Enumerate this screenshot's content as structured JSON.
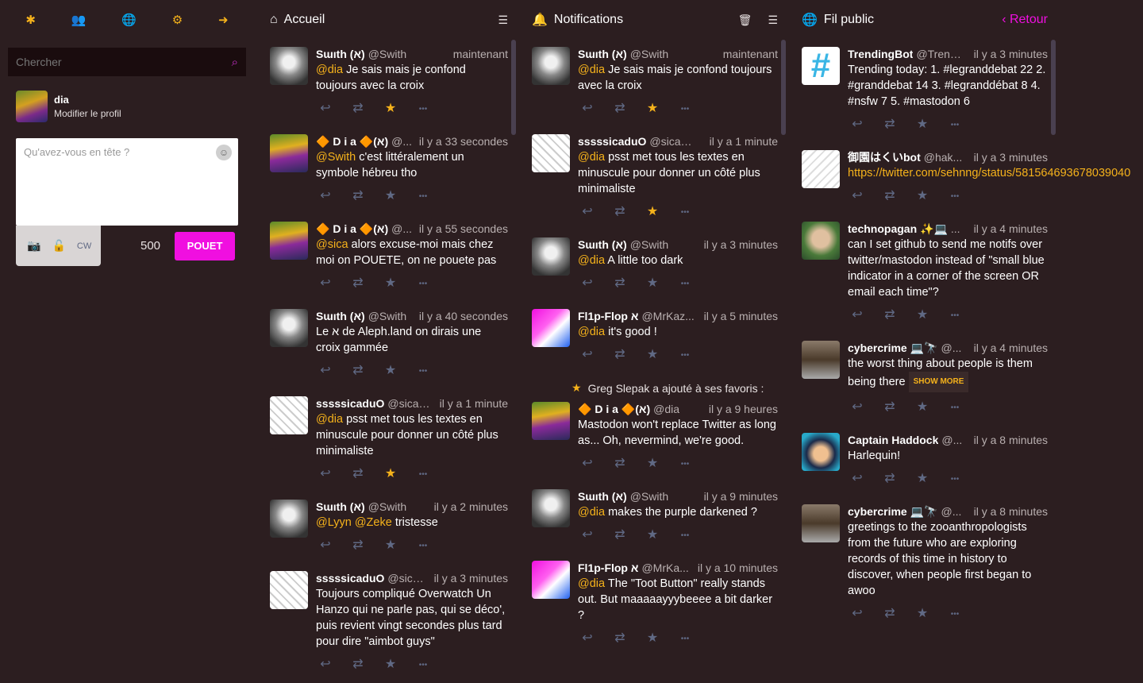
{
  "nav": {
    "items": [
      "getting-started-icon",
      "local-timeline-icon",
      "public-timeline-icon",
      "preferences-icon",
      "logout-icon"
    ]
  },
  "search": {
    "placeholder": "Chercher"
  },
  "profile": {
    "name": "dia",
    "edit": "Modifier le profil"
  },
  "compose": {
    "placeholder": "Qu'avez-vous en tête ?",
    "cw": "CW",
    "count": "500",
    "submit": "POUET"
  },
  "columns": {
    "home": {
      "title": "Accueil"
    },
    "notifications": {
      "title": "Notifications"
    },
    "public": {
      "title": "Fil public",
      "back": "Retour"
    }
  },
  "home": [
    {
      "name": "Sɯıth (א)",
      "acct": "@Swith",
      "time": "maintenant",
      "mention": "@dia",
      "text": " Je sais mais je confond toujours avec la croix",
      "fav": true,
      "avatar": "swith"
    },
    {
      "name": "🔶 D i a 🔶(א)",
      "acct": "@...",
      "time": "il y a 33 secondes",
      "mention": "@Swith",
      "text": " c'est littéralement un symbole hébreu tho",
      "fav": false,
      "avatar": "dia"
    },
    {
      "name": "🔶 D i a 🔶(א)",
      "acct": "@...",
      "time": "il y a 55 secondes",
      "mention": "@sica",
      "text": " alors excuse-moi mais chez moi on POUETE, on ne pouete pas",
      "fav": false,
      "avatar": "dia"
    },
    {
      "name": "Sɯıth (א)",
      "acct": "@Swith",
      "time": "il y a 40 secondes",
      "mention": "",
      "text": "Le א de Aleph.land on dirais une croix gammée",
      "fav": false,
      "avatar": "swith"
    },
    {
      "name": "sssssicaduO",
      "acct": "@sica@i...",
      "time": "il y a 1 minute",
      "mention": "@dia",
      "text": " psst met tous les textes en minuscule pour donner un côté plus minimaliste",
      "fav": true,
      "avatar": "sica"
    },
    {
      "name": "Sɯıth (א)",
      "acct": "@Swith",
      "time": "il y a 2 minutes",
      "mention": "@Lyyn @Zeke",
      "text": " tristesse",
      "fav": false,
      "avatar": "swith"
    },
    {
      "name": "sssssicaduO",
      "acct": "@sica...",
      "time": "il y a 3 minutes",
      "mention": "",
      "text": "Toujours compliqué Overwatch Un Hanzo qui ne parle pas, qui se déco', puis revient vingt secondes plus tard pour dire \"aimbot guys\"",
      "fav": false,
      "avatar": "sica"
    }
  ],
  "notifications": [
    {
      "name": "Sɯıth (א)",
      "acct": "@Swith",
      "time": "maintenant",
      "mention": "@dia",
      "text": " Je sais mais je confond toujours avec la croix",
      "fav": true,
      "avatar": "swith"
    },
    {
      "name": "sssssicaduO",
      "acct": "@sica@i...",
      "time": "il y a 1 minute",
      "mention": "@dia",
      "text": " psst met tous les textes en minuscule pour donner un côté plus minimaliste",
      "fav": true,
      "avatar": "sica"
    },
    {
      "name": "Sɯıth (א)",
      "acct": "@Swith",
      "time": "il y a 3 minutes",
      "mention": "@dia",
      "text": " A little too dark",
      "fav": false,
      "avatar": "swith"
    },
    {
      "name": "Fl1p-Flop א",
      "acct": "@MrKaz...",
      "time": "il y a 5 minutes",
      "mention": "@dia",
      "text": " it's good !",
      "fav": false,
      "avatar": "flip"
    }
  ],
  "notif_fav": {
    "text": "Greg Slepak a ajouté à ses favoris :"
  },
  "notifications2": [
    {
      "name": "🔶 D i a 🔶(א)",
      "acct": "@dia",
      "time": "il y a 9 heures",
      "mention": "",
      "text": "Mastodon won't replace Twitter as long as... Oh, nevermind, we're good.",
      "fav": false,
      "avatar": "greg"
    },
    {
      "name": "Sɯıth (א)",
      "acct": "@Swith",
      "time": "il y a 9 minutes",
      "mention": "@dia",
      "text": " makes the purple darkened ?",
      "fav": false,
      "avatar": "swith"
    },
    {
      "name": "Fl1p-Flop א",
      "acct": "@MrKa...",
      "time": "il y a 10 minutes",
      "mention": "@dia",
      "text": " The \"Toot Button\" really stands out. But maaaaayyybeeee a bit darker ?",
      "fav": false,
      "avatar": "flip"
    }
  ],
  "public": [
    {
      "name": "TrendingBot",
      "acct": "@Trendi...",
      "time": "il y a 3 minutes",
      "mention": "",
      "text": "Trending today: 1. #legranddebat 22 2. #granddebat 14 3. #legranddébat 8 4. #nsfw 7 5. #mastodon 6",
      "fav": false,
      "avatar": "trend"
    },
    {
      "name": "御園はくいbot",
      "acct": "@hak...",
      "time": "il y a 3 minutes",
      "mention": "https://twitter.com/sehnng/status/581564693678039040",
      "text": "",
      "fav": false,
      "avatar": "hak"
    },
    {
      "name": "technopagan ✨💻",
      "acct": "...",
      "time": "il y a 4 minutes",
      "mention": "",
      "text": "can I set github to send me notifs over twitter/mastodon instead of \"small blue indicator in a corner of the screen OR email each time\"?",
      "fav": false,
      "avatar": "techno"
    },
    {
      "name": "cybercrime 💻🔭",
      "acct": "@...",
      "time": "il y a 4 minutes",
      "mention": "",
      "text": "the worst thing about people is them being there",
      "more": "SHOW MORE",
      "fav": false,
      "avatar": "cyber"
    },
    {
      "name": "Captain Haddock",
      "acct": "@...",
      "time": "il y a 8 minutes",
      "mention": "",
      "text": "Harlequin!",
      "fav": false,
      "avatar": "haddock"
    },
    {
      "name": "cybercrime 💻🔭",
      "acct": "@...",
      "time": "il y a 8 minutes",
      "mention": "",
      "text": "greetings to the zooanthropologists from the future who are exploring records of this time in history to discover, when people first began to awoo",
      "fav": false,
      "avatar": "cyber"
    }
  ]
}
